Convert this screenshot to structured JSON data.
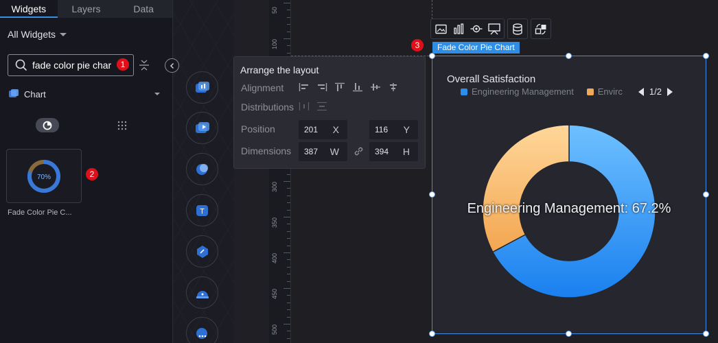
{
  "left_panel": {
    "tabs": [
      {
        "label": "Widgets",
        "active": true
      },
      {
        "label": "Layers",
        "active": false
      },
      {
        "label": "Data",
        "active": false
      }
    ],
    "scope_label": "All Widgets",
    "search": {
      "value": "fade color pie char",
      "step_badge": "1"
    },
    "category": {
      "label": "Chart",
      "icon": "chart-category-icon"
    },
    "widget_card": {
      "thumbnail_text": "70%",
      "label": "Fade Color Pie C...",
      "step_badge": "2"
    }
  },
  "middle_strip": {
    "icons": [
      "bar-widget-icon",
      "video-widget-icon",
      "map-widget-icon",
      "text-widget-icon",
      "graphic-widget-icon",
      "alarm-widget-icon",
      "more-widget-icon"
    ]
  },
  "ruler": {
    "labels": [
      "50",
      "100",
      "300",
      "350",
      "400",
      "450",
      "500"
    ]
  },
  "arrange_popup": {
    "title": "Arrange the layout",
    "alignment_label": "Alignment",
    "distributions_label": "Distributions",
    "position_label": "Position",
    "dimensions_label": "Dimensions",
    "position": {
      "x": "201",
      "x_unit": "X",
      "y": "116",
      "y_unit": "Y"
    },
    "dimensions": {
      "w": "387",
      "w_unit": "W",
      "h": "394",
      "h_unit": "H"
    }
  },
  "component": {
    "label": "Fade Color Pie Chart",
    "step_badge": "3"
  },
  "chart_data": {
    "type": "pie",
    "donut": true,
    "title": "Overall Satisfaction",
    "legend": [
      {
        "label": "Engineering Management",
        "color": "#2b8df0"
      },
      {
        "label": "Envirc",
        "color": "#f0a85a"
      }
    ],
    "legend_page": "1/2",
    "slices": [
      {
        "label": "Engineering Management",
        "value": 67.2,
        "color_start": "#6ec0ff",
        "color_end": "#1a80ef"
      },
      {
        "label": "Environment",
        "value": 32.8,
        "color_start": "#ffd79a",
        "color_end": "#f3a650"
      }
    ],
    "center_text": "Engineering Management: 67.2%"
  }
}
